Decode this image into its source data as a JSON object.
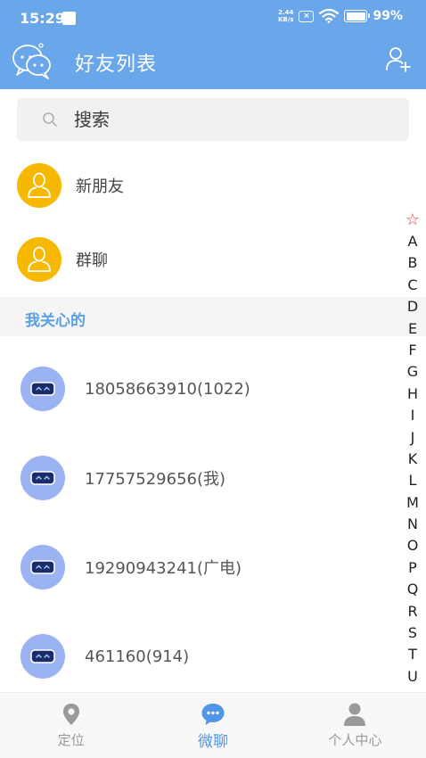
{
  "status_bar": {
    "time": "15:29",
    "net_speed_value": "2.44",
    "net_speed_unit": "KB/s",
    "battery": "99%"
  },
  "header": {
    "title": "好友列表"
  },
  "search": {
    "placeholder": "搜索"
  },
  "special_rows": [
    {
      "label": "新朋友"
    },
    {
      "label": "群聊"
    }
  ],
  "section": {
    "label": "我关心的"
  },
  "contacts": [
    {
      "name": "18058663910(1022)"
    },
    {
      "name": "17757529656(我)"
    },
    {
      "name": "19290943241(广电)"
    },
    {
      "name": "461160(914)"
    }
  ],
  "alpha_index": {
    "star": "☆",
    "letters": [
      "A",
      "B",
      "C",
      "D",
      "E",
      "F",
      "G",
      "H",
      "I",
      "J",
      "K",
      "L",
      "M",
      "N",
      "O",
      "P",
      "Q",
      "R",
      "S",
      "T",
      "U"
    ]
  },
  "bottom_nav": [
    {
      "label": "定位",
      "icon": "location-pin-icon",
      "active": false
    },
    {
      "label": "微聊",
      "icon": "chat-bubble-icon",
      "active": true
    },
    {
      "label": "个人中心",
      "icon": "person-icon",
      "active": false
    }
  ],
  "colors": {
    "primary": "#6aa6ea",
    "accent": "#4f95e8",
    "avatar_yellow": "#f7b900",
    "avatar_blue": "#9bb3f2",
    "star_red": "#e23b3b"
  }
}
